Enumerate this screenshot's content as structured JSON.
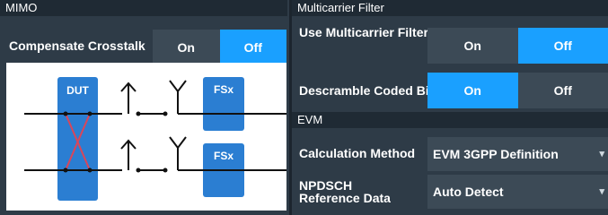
{
  "mimo": {
    "header": "MIMO",
    "compensate_crosstalk": {
      "label": "Compensate Crosstalk",
      "on": "On",
      "off": "Off",
      "selected": "Off"
    },
    "diagram": {
      "dut_label": "DUT",
      "fsx1_label": "FSx",
      "fsx2_label": "FSx"
    }
  },
  "multicarrier": {
    "header": "Multicarrier Filter",
    "use_filter": {
      "label": "Use Multicarrier Filter",
      "on": "On",
      "off": "Off",
      "selected": "Off"
    },
    "descramble": {
      "label": "Descramble Coded Bits",
      "on": "On",
      "off": "Off",
      "selected": "On"
    }
  },
  "evm": {
    "header": "EVM",
    "calculation_method": {
      "label": "Calculation Method",
      "value": "EVM 3GPP Definition"
    },
    "npdsch": {
      "label_line1": "NPDSCH",
      "label_line2": "Reference Data",
      "value": "Auto Detect"
    }
  },
  "colors": {
    "accent": "#1aa0ff",
    "panel": "#2e3b47",
    "control": "#3c4a56",
    "header": "#1f2a34",
    "fsx_block": "#2b7ed2",
    "crosstalk": "#d9465a"
  }
}
